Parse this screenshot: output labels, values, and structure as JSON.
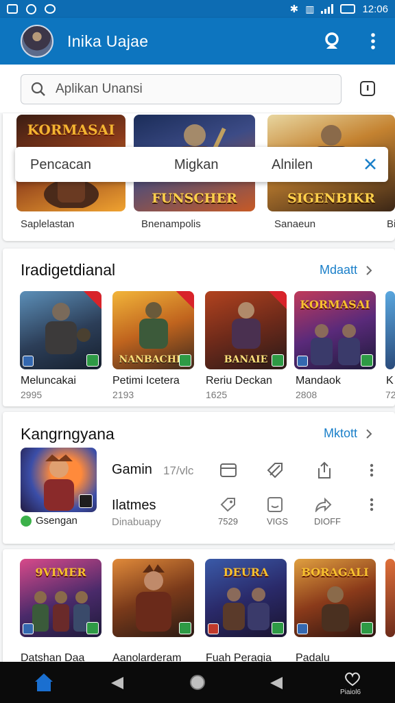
{
  "status_bar": {
    "time": "12:06"
  },
  "app_bar": {
    "title": "Inika Uajae"
  },
  "search": {
    "placeholder": "Aplikan Unansi"
  },
  "featured": {
    "items": [
      {
        "caption": "Saplelastan",
        "banner_top": "KORMASAI",
        "banner_bottom": ""
      },
      {
        "caption": "Bnenampolis",
        "banner_top": "",
        "banner_bottom": "FUNSCHER"
      },
      {
        "caption": "Sanaeun",
        "banner_top": "",
        "banner_bottom": "SIGENBIKR"
      },
      {
        "caption": "Bi",
        "banner_top": "",
        "banner_bottom": ""
      }
    ],
    "tabs_popup": {
      "tabs": [
        "Pencacan",
        "Migkan",
        "Alnilen"
      ]
    }
  },
  "section1": {
    "title": "Iradigetdianal",
    "link": "Mdaatt",
    "items": [
      {
        "name": "Meluncakai",
        "count": "2995",
        "banner": ""
      },
      {
        "name": "Petimi Icetera",
        "count": "2193",
        "banner": "NANBACHIS"
      },
      {
        "name": "Reriu Deckan",
        "count": "1625",
        "banner": "BANAIE"
      },
      {
        "name": "Mandaok",
        "count": "2808",
        "banner": "KORMASAI"
      },
      {
        "name": "K",
        "count": "72",
        "banner": ""
      }
    ]
  },
  "section2": {
    "title": "Kangrngyana",
    "link": "Mktott",
    "item": {
      "title": "Gamin",
      "title_meta": "17/vlc",
      "row2_title": "Ilatmes",
      "row2_sub": "Dinabuapy",
      "badge": "Gsengan",
      "stats": [
        "7529",
        "VIGS",
        "DIOFF"
      ]
    }
  },
  "section3": {
    "items": [
      {
        "name": "Datshan Daa",
        "banner": "9VIMER"
      },
      {
        "name": "Aanolarderam",
        "banner": ""
      },
      {
        "name": "Fuah Peragia",
        "banner": "DEURA"
      },
      {
        "name": "Padalu",
        "banner": "BORAGALI"
      },
      {
        "name": "",
        "banner": ""
      }
    ]
  },
  "nav": {
    "label": "Piaiol6"
  },
  "colors": {
    "primary": "#0d75bf",
    "accent": "#1a7fc9",
    "green": "#2e9a45"
  }
}
